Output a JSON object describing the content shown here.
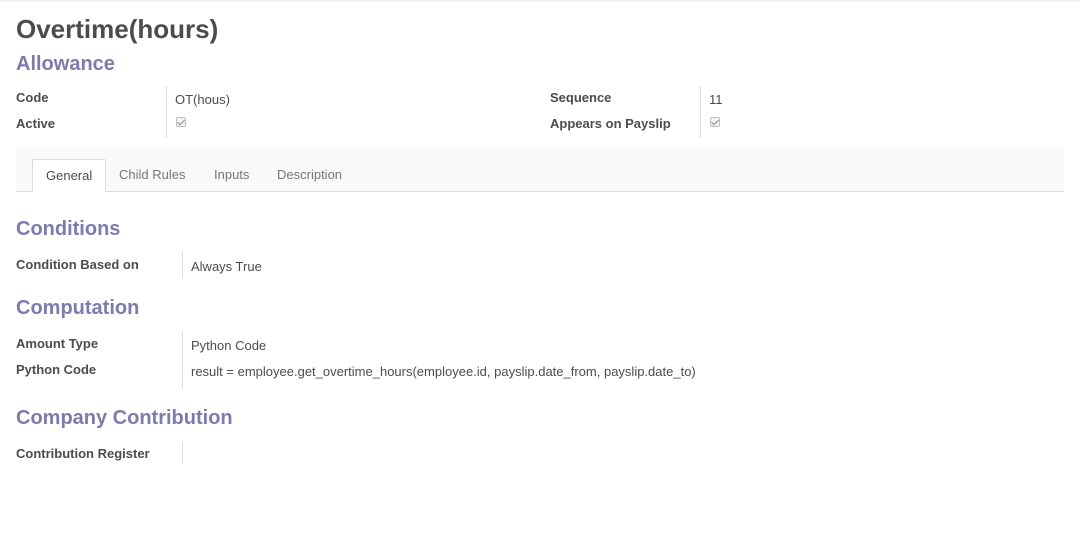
{
  "record": {
    "title": "Overtime(hours)",
    "category": "Allowance"
  },
  "header_fields": {
    "code_label": "Code",
    "code_value": "OT(hous)",
    "active_label": "Active",
    "active_checked": true,
    "sequence_label": "Sequence",
    "sequence_value": "11",
    "payslip_label": "Appears on Payslip",
    "payslip_checked": true
  },
  "tabs": [
    {
      "label": "General",
      "active": true
    },
    {
      "label": "Child Rules",
      "active": false
    },
    {
      "label": "Inputs",
      "active": false
    },
    {
      "label": "Description",
      "active": false
    }
  ],
  "conditions": {
    "title": "Conditions",
    "based_on_label": "Condition Based on",
    "based_on_value": "Always True"
  },
  "computation": {
    "title": "Computation",
    "amount_type_label": "Amount Type",
    "amount_type_value": "Python Code",
    "python_code_label": "Python Code",
    "python_code_value": "result = employee.get_overtime_hours(employee.id, payslip.date_from, payslip.date_to)"
  },
  "company_contribution": {
    "title": "Company Contribution",
    "register_label": "Contribution Register",
    "register_value": ""
  },
  "colors": {
    "accent": "#7c7bad",
    "text": "#4c4c4c",
    "muted": "#777777",
    "border": "#dcdcdc"
  }
}
